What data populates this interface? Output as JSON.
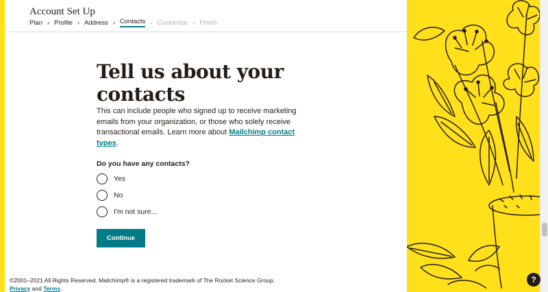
{
  "header": {
    "title": "Account Set Up",
    "breadcrumb": [
      "Plan",
      "Profile",
      "Address",
      "Contacts",
      "Customize",
      "Finish"
    ],
    "active_step": "Contacts"
  },
  "main": {
    "heading": "Tell us about your contacts",
    "description": "This can include people who signed up to receive marketing emails from your organization, or those who solely receive transactional emails. Learn more about ",
    "link": "Mailchimp contact types",
    "description_end": ".",
    "question": "Do you have any contacts?",
    "options": [
      "Yes",
      "No",
      "I'm not sure..."
    ],
    "continue_label": "Continue"
  },
  "footer": {
    "copyright": "©2001–2021 All Rights Reserved. Mailchimp® is a registered trademark of The Rocket Science Group.",
    "privacy": "Privacy",
    "and": "and",
    "terms": "Terms",
    "period": "."
  },
  "help": {
    "label": "?"
  },
  "colors": {
    "brand_yellow": "#ffe01b",
    "accent_teal": "#007c89",
    "text": "#241c15"
  },
  "icons": [
    "chevron-right-icon",
    "help-icon"
  ]
}
